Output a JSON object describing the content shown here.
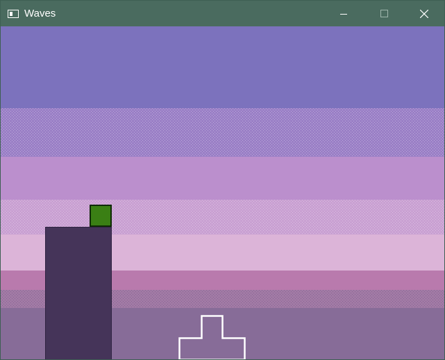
{
  "window": {
    "title": "Waves",
    "controls": {
      "minimize_icon": "minimize-icon",
      "maximize_icon": "maximize-icon",
      "close_icon": "close-icon"
    }
  },
  "scene": {
    "colors": {
      "sky_top": "#7c72bd",
      "sky_mid": "#bb8fcd",
      "sky_low": "#dcb4d8",
      "water_top": "#b97aad",
      "water": "#876c98",
      "pillar": "#453459",
      "player": "#3a7f14",
      "outline": "#ffffff"
    }
  }
}
